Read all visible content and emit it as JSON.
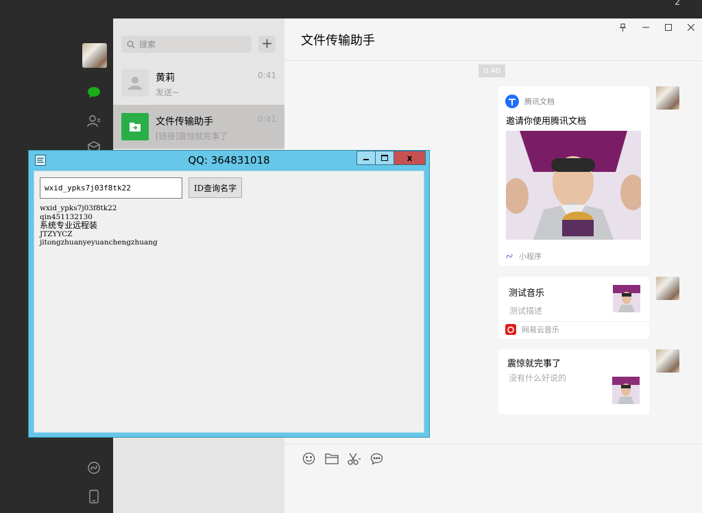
{
  "desktop": {
    "number": "2"
  },
  "sidebar": {
    "icons": [
      "chat-icon",
      "contacts-icon",
      "favorites-icon",
      "miniprogram-icon",
      "phone-icon"
    ]
  },
  "chat_list": {
    "search_placeholder": "搜索",
    "add_label": "+",
    "items": [
      {
        "name": "黄莉",
        "time": "0:41",
        "preview": "发送~"
      },
      {
        "name": "文件传输助手",
        "time": "0:41",
        "preview": "[链接]震惊就完事了"
      }
    ]
  },
  "chat": {
    "title": "文件传输助手",
    "timestamp": "0:40",
    "messages": [
      {
        "type": "miniprogram",
        "app_name": "腾讯文档",
        "title": "邀请你使用腾讯文档",
        "footer": "小程序"
      },
      {
        "type": "music",
        "title": "测试音乐",
        "desc": "测试描述",
        "footer": "网易云音乐"
      },
      {
        "type": "link",
        "title": "震惊就完事了",
        "desc": "没有什么好说的"
      }
    ]
  },
  "qq_tool": {
    "title": "QQ: 364831018",
    "input_value": "wxid_ypks7j03f8tk22",
    "query_label": "ID查询名字",
    "close_label": "x",
    "results": [
      "wxid_ypks7j03f8tk22",
      "qin451132130",
      "系统专业远程装",
      "JTZYYCZ",
      "jitongzhuanyeyuanchengzhuang"
    ]
  }
}
